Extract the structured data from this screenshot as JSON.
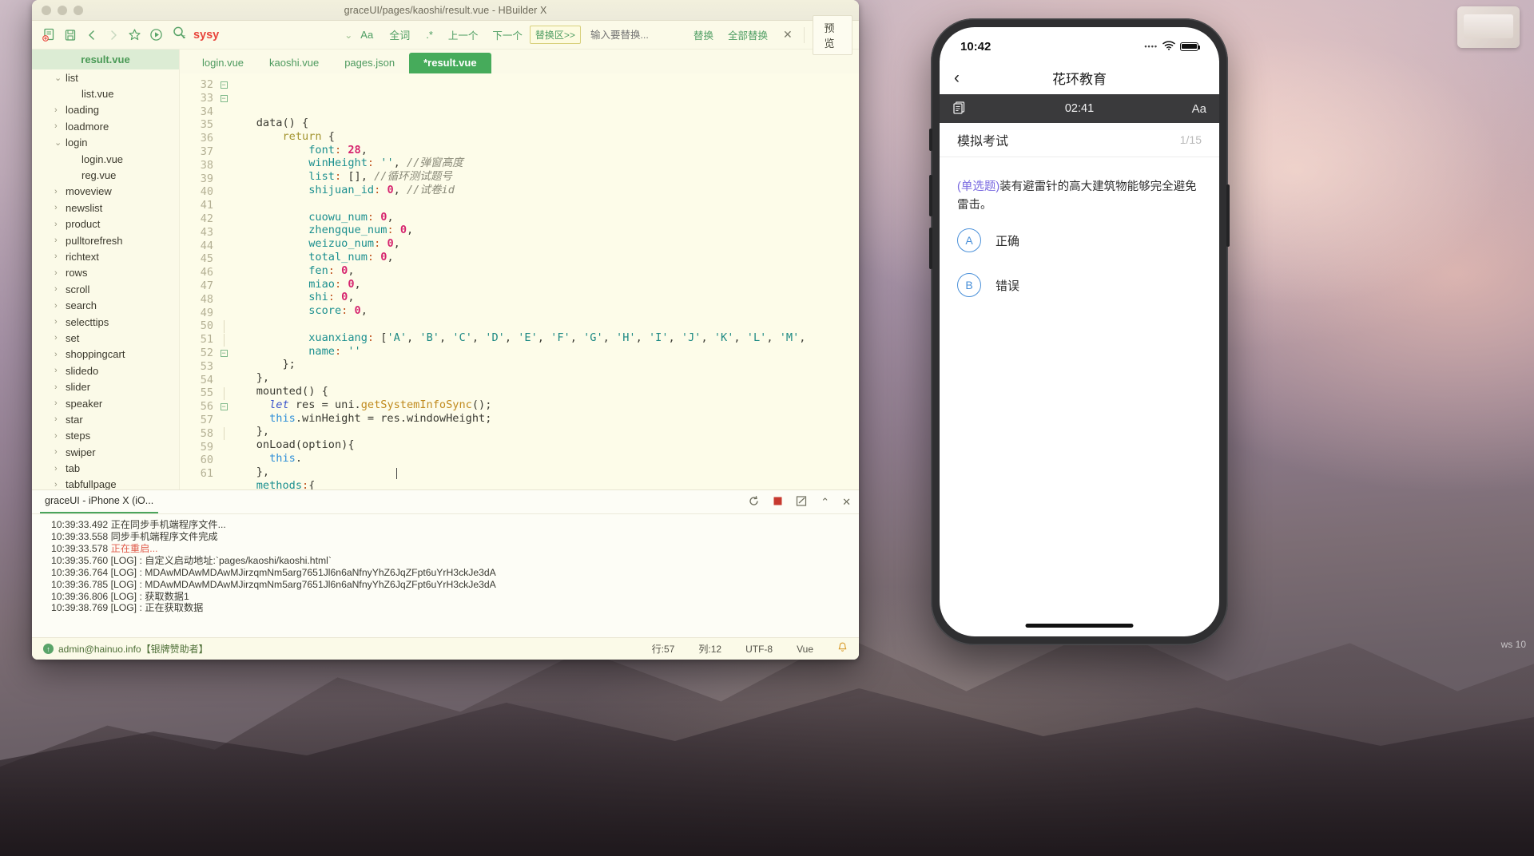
{
  "window": {
    "title": "graceUI/pages/kaoshi/result.vue - HBuilder X"
  },
  "toolbar": {
    "search_value": "sysy",
    "replace_placeholder": "输入要替换...",
    "case_label": "Aa",
    "word_label": "全词",
    "regex_label": ".*",
    "prev_label": "上一个",
    "next_label": "下一个",
    "replace_area_label": "替换区>>",
    "replace_label": "替换",
    "replace_all_label": "全部替换",
    "close_label": "✕",
    "preview_label": "预览",
    "caret_label": "⌄"
  },
  "sidebar": {
    "header": "result.vue",
    "items": [
      {
        "label": "list",
        "type": "folder",
        "state": "open",
        "indent": 0
      },
      {
        "label": "list.vue",
        "type": "file",
        "state": "",
        "indent": 1
      },
      {
        "label": "loading",
        "type": "folder",
        "state": "closed",
        "indent": 0
      },
      {
        "label": "loadmore",
        "type": "folder",
        "state": "closed",
        "indent": 0
      },
      {
        "label": "login",
        "type": "folder",
        "state": "open",
        "indent": 0
      },
      {
        "label": "login.vue",
        "type": "file",
        "state": "",
        "indent": 1
      },
      {
        "label": "reg.vue",
        "type": "file",
        "state": "",
        "indent": 1
      },
      {
        "label": "moveview",
        "type": "folder",
        "state": "closed",
        "indent": 0
      },
      {
        "label": "newslist",
        "type": "folder",
        "state": "closed",
        "indent": 0
      },
      {
        "label": "product",
        "type": "folder",
        "state": "closed",
        "indent": 0
      },
      {
        "label": "pulltorefresh",
        "type": "folder",
        "state": "closed",
        "indent": 0
      },
      {
        "label": "richtext",
        "type": "folder",
        "state": "closed",
        "indent": 0
      },
      {
        "label": "rows",
        "type": "folder",
        "state": "closed",
        "indent": 0
      },
      {
        "label": "scroll",
        "type": "folder",
        "state": "closed",
        "indent": 0
      },
      {
        "label": "search",
        "type": "folder",
        "state": "closed",
        "indent": 0
      },
      {
        "label": "selecttips",
        "type": "folder",
        "state": "closed",
        "indent": 0
      },
      {
        "label": "set",
        "type": "folder",
        "state": "closed",
        "indent": 0
      },
      {
        "label": "shoppingcart",
        "type": "folder",
        "state": "closed",
        "indent": 0
      },
      {
        "label": "slidedo",
        "type": "folder",
        "state": "closed",
        "indent": 0
      },
      {
        "label": "slider",
        "type": "folder",
        "state": "closed",
        "indent": 0
      },
      {
        "label": "speaker",
        "type": "folder",
        "state": "closed",
        "indent": 0
      },
      {
        "label": "star",
        "type": "folder",
        "state": "closed",
        "indent": 0
      },
      {
        "label": "steps",
        "type": "folder",
        "state": "closed",
        "indent": 0
      },
      {
        "label": "swiper",
        "type": "folder",
        "state": "closed",
        "indent": 0
      },
      {
        "label": "tab",
        "type": "folder",
        "state": "closed",
        "indent": 0
      },
      {
        "label": "tabfullpage",
        "type": "folder",
        "state": "closed",
        "indent": 0
      }
    ]
  },
  "editor": {
    "tabs": [
      {
        "label": "login.vue",
        "active": false
      },
      {
        "label": "kaoshi.vue",
        "active": false
      },
      {
        "label": "pages.json",
        "active": false
      },
      {
        "label": "*result.vue",
        "active": true
      }
    ],
    "first_line": 32,
    "lines": [
      {
        "n": 32,
        "fold": "box",
        "text": "    data() {"
      },
      {
        "n": 33,
        "fold": "box",
        "text": "        return {"
      },
      {
        "n": 34,
        "fold": "",
        "text": "            font: 28,"
      },
      {
        "n": 35,
        "fold": "",
        "text": "            winHeight: '', //弹窗高度"
      },
      {
        "n": 36,
        "fold": "",
        "text": "            list: [], //循环测试题号"
      },
      {
        "n": 37,
        "fold": "",
        "text": "            shijuan_id: 0, //试卷id"
      },
      {
        "n": 38,
        "fold": "",
        "text": ""
      },
      {
        "n": 39,
        "fold": "",
        "text": "            cuowu_num: 0,"
      },
      {
        "n": 40,
        "fold": "",
        "text": "            zhengque_num: 0,"
      },
      {
        "n": 41,
        "fold": "",
        "text": "            weizuo_num: 0,"
      },
      {
        "n": 42,
        "fold": "",
        "text": "            total_num: 0,"
      },
      {
        "n": 43,
        "fold": "",
        "text": "            fen: 0,"
      },
      {
        "n": 44,
        "fold": "",
        "text": "            miao: 0,"
      },
      {
        "n": 45,
        "fold": "",
        "text": "            shi: 0,"
      },
      {
        "n": 46,
        "fold": "",
        "text": "            score: 0,"
      },
      {
        "n": 47,
        "fold": "",
        "text": ""
      },
      {
        "n": 48,
        "fold": "",
        "text": "            xuanxiang: ['A', 'B', 'C', 'D', 'E', 'F', 'G', 'H', 'I', 'J', 'K', 'L', 'M',"
      },
      {
        "n": 49,
        "fold": "",
        "text": "            name: ''"
      },
      {
        "n": 50,
        "fold": "bar",
        "text": "        };"
      },
      {
        "n": 51,
        "fold": "bar",
        "text": "    },"
      },
      {
        "n": 52,
        "fold": "box",
        "text": "    mounted() {"
      },
      {
        "n": 53,
        "fold": "",
        "text": "      let res = uni.getSystemInfoSync();"
      },
      {
        "n": 54,
        "fold": "",
        "text": "      this.winHeight = res.windowHeight;"
      },
      {
        "n": 55,
        "fold": "bar",
        "text": "    },"
      },
      {
        "n": 56,
        "fold": "box",
        "text": "    onLoad(option){"
      },
      {
        "n": 57,
        "fold": "",
        "text": "      this."
      },
      {
        "n": 58,
        "fold": "bar",
        "text": "    },"
      },
      {
        "n": 59,
        "fold": "",
        "text": "    methods:{"
      },
      {
        "n": 60,
        "fold": "",
        "text": ""
      },
      {
        "n": 61,
        "fold": "",
        "text": "      }"
      }
    ]
  },
  "console": {
    "tab_label": "graceUI - iPhone X (iO...",
    "actions": [
      "refresh-icon",
      "stop-icon",
      "clear-icon",
      "collapse-icon",
      "close-icon"
    ],
    "logs": [
      {
        "time": "10:39:33.492",
        "text": "正在同步手机端程序文件...",
        "error": false
      },
      {
        "time": "10:39:33.558",
        "text": "同步手机端程序文件完成",
        "error": false
      },
      {
        "time": "10:39:33.578",
        "text": "正在重启...",
        "error": true
      },
      {
        "time": "10:39:35.760",
        "text": "[LOG] : 自定义启动地址:`pages/kaoshi/kaoshi.html`",
        "error": false
      },
      {
        "time": "10:39:36.764",
        "text": "[LOG] : MDAwMDAwMDAwMJirzqmNm5arg7651Jl6n6aNfnyYhZ6JqZFpt6uYrH3ckJe3dA",
        "error": false
      },
      {
        "time": "10:39:36.785",
        "text": "[LOG] : MDAwMDAwMDAwMJirzqmNm5arg7651Jl6n6aNfnyYhZ6JqZFpt6uYrH3ckJe3dA",
        "error": false
      },
      {
        "time": "10:39:36.806",
        "text": "[LOG] : 获取数据1",
        "error": false
      },
      {
        "time": "10:39:38.769",
        "text": "[LOG] : 正在获取数据",
        "error": false
      }
    ]
  },
  "statusbar": {
    "user": "admin@hainuo.info【银牌赞助者】",
    "line": "行:57",
    "column": "列:12",
    "encoding": "UTF-8",
    "language": "Vue",
    "bell": "🔔"
  },
  "phone": {
    "status": {
      "time": "10:42",
      "dots": "••••",
      "wifi": "wifi-icon",
      "battery": "battery-icon"
    },
    "nav": {
      "back": "‹",
      "title": "花环教育"
    },
    "devbar": {
      "left_icon": "pages-icon",
      "timer": "02:41",
      "right_label": "Aa"
    },
    "exam": {
      "title": "模拟考试",
      "counter": "1/15",
      "question_type": "(单选题)",
      "question_text": "装有避雷针的高大建筑物能够完全避免雷击。",
      "options": [
        {
          "key": "A",
          "label": "正确"
        },
        {
          "key": "B",
          "label": "错误"
        }
      ]
    }
  },
  "desktop": {
    "corner_label": "ws 10"
  }
}
